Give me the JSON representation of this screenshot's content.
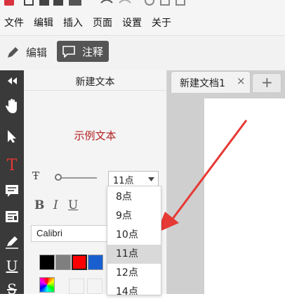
{
  "menu": [
    "文件",
    "编辑",
    "插入",
    "页面",
    "设置",
    "关于"
  ],
  "modes": {
    "edit": "编辑",
    "annotate": "注释"
  },
  "panel": {
    "title": "新建文本",
    "sample_text": "示例文本",
    "size_value": "11点",
    "font_name": "Calibri",
    "format_buttons": [
      "B",
      "I",
      "U"
    ]
  },
  "tabs": {
    "doc_tab": "新建文档1",
    "close": "×",
    "new_tab": "+"
  },
  "size_options": [
    "8点",
    "9点",
    "10点",
    "11点",
    "12点",
    "14点"
  ],
  "selected_size": "11点",
  "colors": {
    "accent_red": "#e53935",
    "sample_text_red": "#b21f1f",
    "toolbar_dark": "#3a3a3a",
    "swatches": [
      "#000000",
      "#7f7f7f",
      "#ff0000",
      "#1a5fd0"
    ]
  }
}
